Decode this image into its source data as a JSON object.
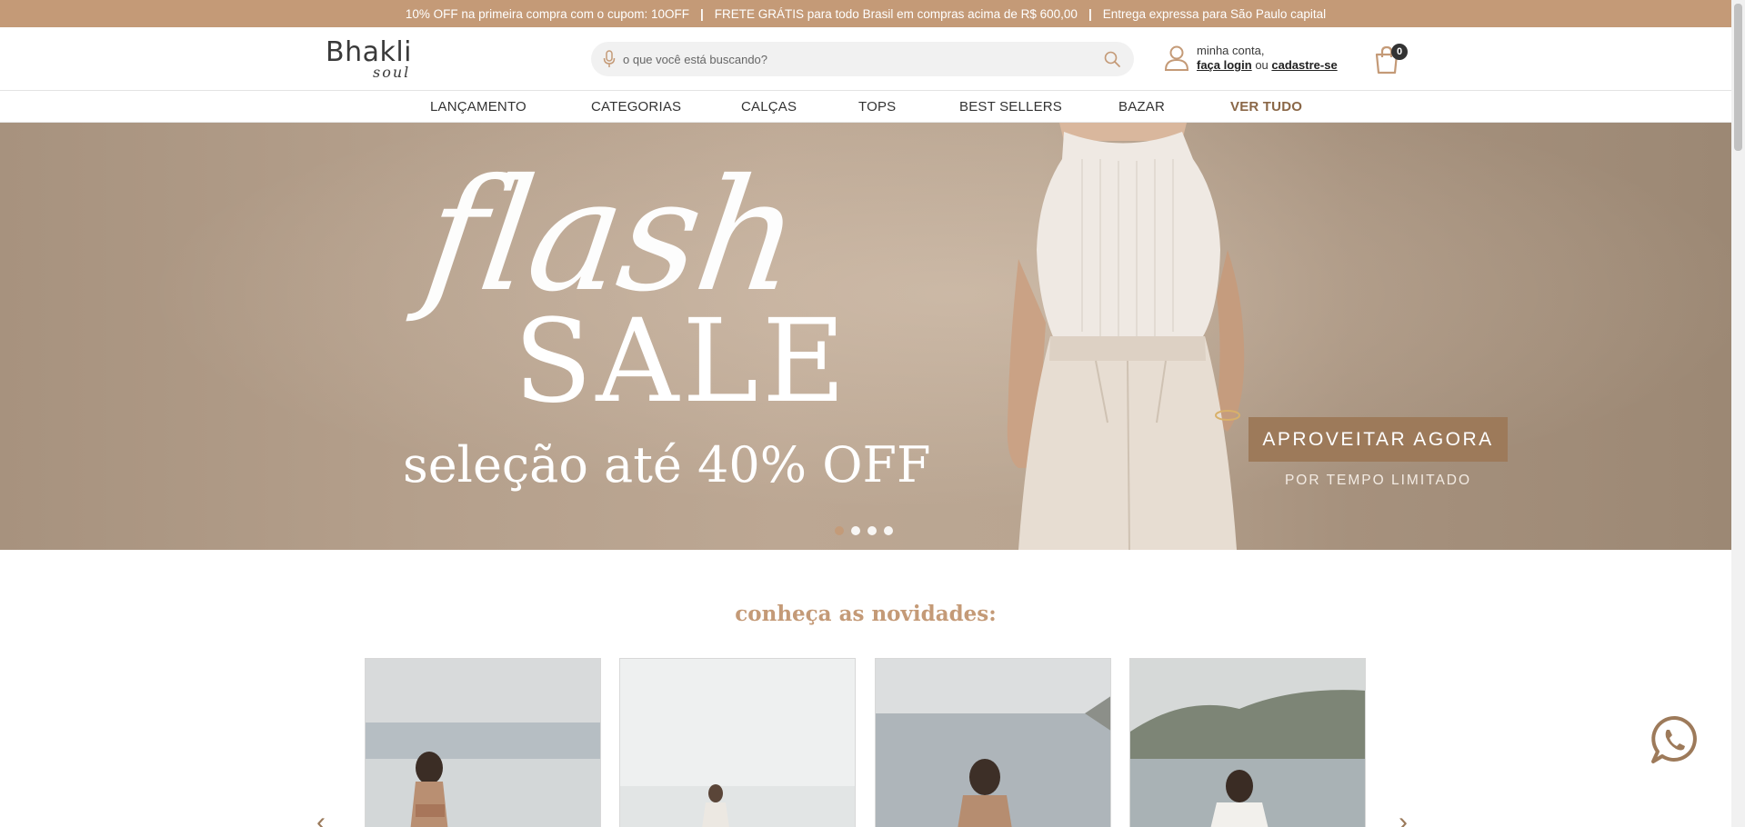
{
  "topbar": {
    "msg1": "10% OFF na primeira compra com o cupom: 10OFF",
    "msg2": "FRETE GRÁTIS para todo Brasil em compras acima de R$ 600,00",
    "msg3": "Entrega expressa para São Paulo capital",
    "separator": "|"
  },
  "header": {
    "logo_main": "Bhakli",
    "logo_script": "soul",
    "search_placeholder": "o que você está buscando?",
    "account_greeting": "minha conta,",
    "login_link": "faça login",
    "or_text": "ou",
    "signup_link": "cadastre-se",
    "cart_count": "0"
  },
  "nav": {
    "items": [
      {
        "label": "LANÇAMENTO"
      },
      {
        "label": "CATEGORIAS"
      },
      {
        "label": "CALÇAS"
      },
      {
        "label": "TOPS"
      },
      {
        "label": "BEST SELLERS"
      },
      {
        "label": "BAZAR"
      },
      {
        "label": "VER TUDO"
      }
    ]
  },
  "hero": {
    "flash": "flash",
    "sale": "SALE",
    "subtitle": "seleção até 40% OFF",
    "cta": "APROVEITAR AGORA",
    "limited": "POR TEMPO LIMITADO",
    "slides": 4,
    "active_slide": 1
  },
  "novidades": {
    "title": "conheça as novidades:",
    "prev": "‹",
    "next": "›"
  },
  "colors": {
    "brand": "#c49a77",
    "cta": "#9d7a5a",
    "accent_text": "#8a6747"
  }
}
